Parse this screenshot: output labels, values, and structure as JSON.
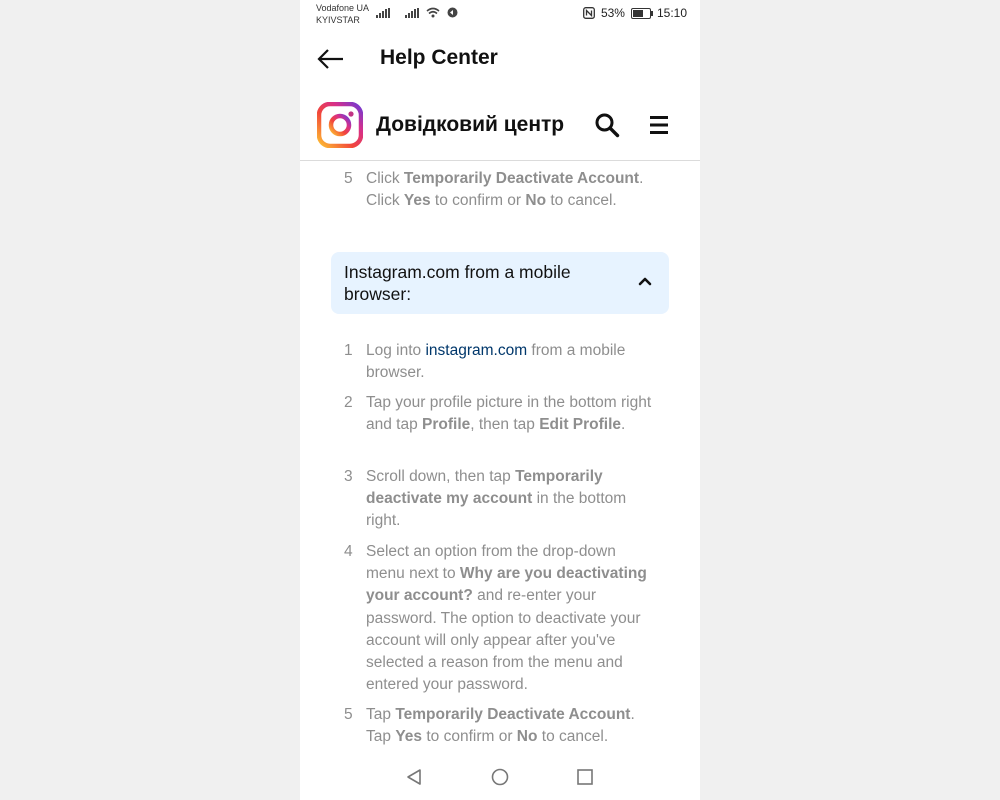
{
  "status_bar": {
    "carrier_line1": "Vodafone UA",
    "carrier_line2": "KYIVSTAR",
    "battery": "53%",
    "time": "15:10"
  },
  "app_bar": {
    "title": "Help Center"
  },
  "site_header": {
    "title": "Довідковий центр"
  },
  "desktop_step5": {
    "number": "5",
    "p1": "Click ",
    "b1": "Temporarily Deactivate Account",
    "p2": ". Click ",
    "b2": "Yes",
    "p3": " to confirm or ",
    "b3": "No",
    "p4": " to cancel."
  },
  "accordion": {
    "title": "Instagram.com from a mobile browser:"
  },
  "steps": {
    "s1": {
      "number": "1",
      "p1": "Log into ",
      "link": "instagram.com",
      "p2": " from a mobile browser."
    },
    "s2": {
      "number": "2",
      "p1": "Tap your profile picture in the bottom right and tap ",
      "b1": "Profile",
      "p2": ", then tap ",
      "b2": "Edit Profile",
      "p3": "."
    },
    "s3": {
      "number": "3",
      "p1": "Scroll down, then tap ",
      "b1": "Temporarily deactivate my account",
      "p2": " in the bottom right."
    },
    "s4": {
      "number": "4",
      "p1": "Select an option from the drop-down menu next to ",
      "b1": "Why are you deactivating your account?",
      "p2": " and re-enter your password. The option to deactivate your account will only appear after you've selected a reason from the menu and entered your password."
    },
    "s5": {
      "number": "5",
      "p1": "Tap ",
      "b1": "Temporarily Deactivate Account",
      "p2": ". Tap ",
      "b2": "Yes",
      "p3": " to confirm or ",
      "b3": "No",
      "p4": " to cancel."
    }
  },
  "icons": {
    "back": "arrow-left-icon",
    "logo": "instagram-logo-icon",
    "search": "search-icon",
    "menu": "hamburger-menu-icon",
    "accordion": "chevron-up-icon",
    "nav_back": "triangle-back-icon",
    "nav_home": "circle-home-icon",
    "nav_recent": "square-recents-icon"
  },
  "colors": {
    "accordion_bg": "#e7f3ff",
    "link": "#00376b",
    "muted_text": "#8e8e8e"
  }
}
